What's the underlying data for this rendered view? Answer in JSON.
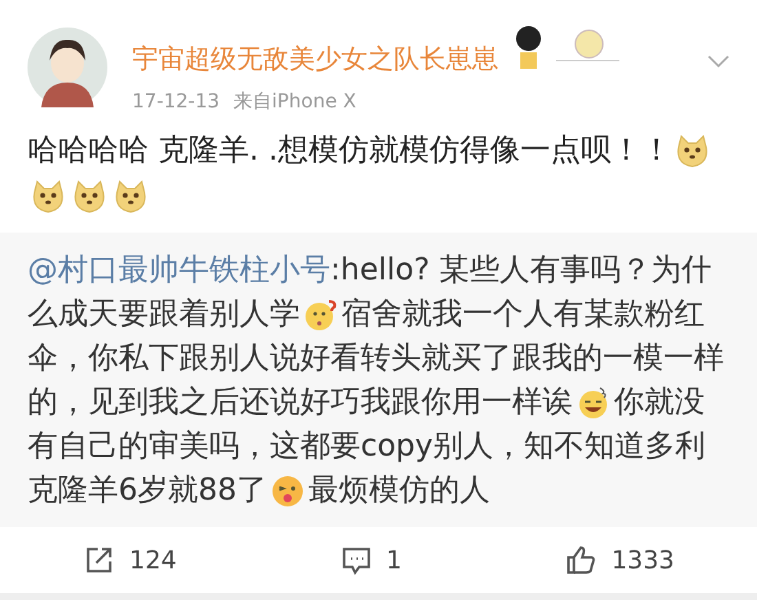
{
  "author": {
    "name": "宇宙超级无敌美少女之队长崽崽",
    "time": "17-12-13",
    "source": "来自iPhone X"
  },
  "post": [
    {
      "kind": "text",
      "text": "哈哈哈哈 克隆羊. .想模仿就模仿得像一点呗！！"
    },
    {
      "kind": "doge"
    },
    {
      "kind": "doge"
    },
    {
      "kind": "doge"
    },
    {
      "kind": "doge"
    }
  ],
  "repost": [
    {
      "kind": "mention",
      "text": "@村口最帅牛铁柱小号"
    },
    {
      "kind": "text",
      "text": ":hello?  某些人有事吗？为什么成天要跟着别人学"
    },
    {
      "kind": "thinking"
    },
    {
      "kind": "text",
      "text": "宿舍就我一个人有某款粉红伞，你私下跟别人说好看转头就买了跟我的一模一样的，见到我之后还说好巧我跟你用一样诶"
    },
    {
      "kind": "sweat"
    },
    {
      "kind": "text",
      "text": "你就没有自己的审美吗，这都要copy别人，知不知道多利克隆羊6岁就88了"
    },
    {
      "kind": "tongue"
    },
    {
      "kind": "text",
      "text": "最烦模仿的人"
    }
  ],
  "actions": [
    {
      "kind": "share",
      "count": "124"
    },
    {
      "kind": "comment",
      "count": "1"
    },
    {
      "kind": "like",
      "count": "1333"
    }
  ]
}
